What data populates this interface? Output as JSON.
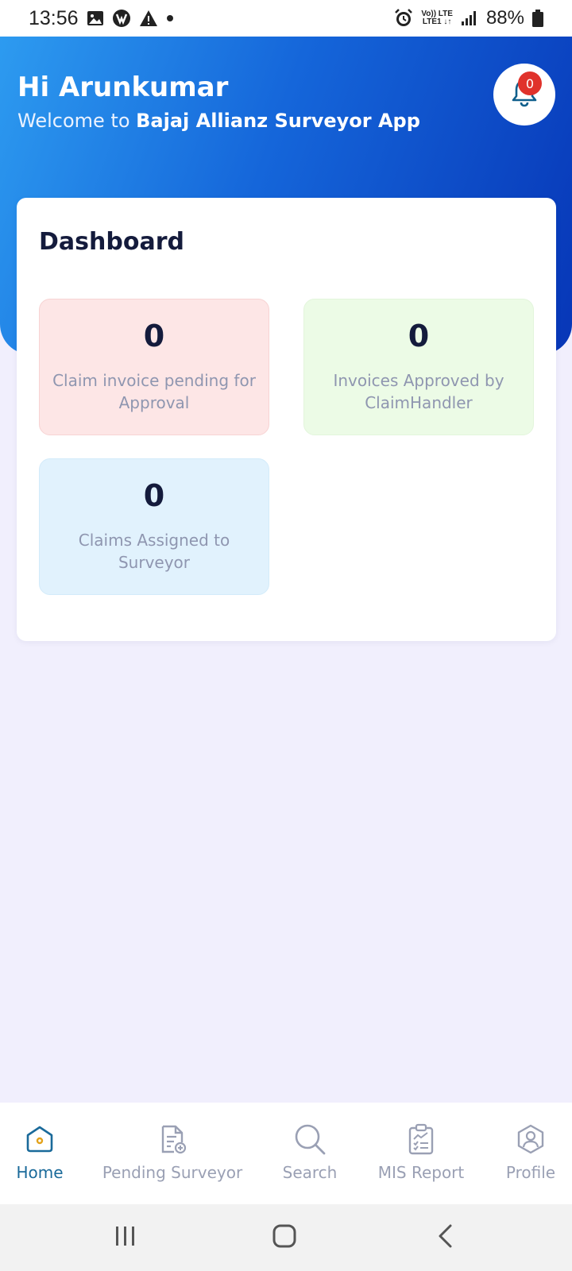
{
  "status_bar": {
    "time": "13:56",
    "network_top": "Vo)) LTE",
    "network_bottom": "LTE1 ↓↑",
    "battery_percent": "88%"
  },
  "header": {
    "greeting": "Hi Arunkumar",
    "welcome_prefix": "Welcome to ",
    "app_name": "Bajaj Allianz Surveyor App",
    "notification_count": "0"
  },
  "dashboard": {
    "title": "Dashboard",
    "cards": [
      {
        "value": "0",
        "label": "Claim invoice pending for Approval"
      },
      {
        "value": "0",
        "label": "Invoices Approved by ClaimHandler"
      },
      {
        "value": "0",
        "label": "Claims Assigned to Surveyor"
      }
    ]
  },
  "bottom_nav": {
    "items": [
      {
        "label": "Home",
        "icon": "home-icon",
        "active": true
      },
      {
        "label": "Pending Surveyor",
        "icon": "document-add-icon"
      },
      {
        "label": "Search",
        "icon": "search-icon"
      },
      {
        "label": "MIS Report",
        "icon": "clipboard-report-icon"
      },
      {
        "label": "Profile",
        "icon": "profile-icon"
      }
    ]
  },
  "colors": {
    "header_gradient_start": "#2d9bf0",
    "header_gradient_end": "#0736b7",
    "background": "#f1effd",
    "active_nav": "#1a6a9a",
    "badge": "#e0322b"
  }
}
